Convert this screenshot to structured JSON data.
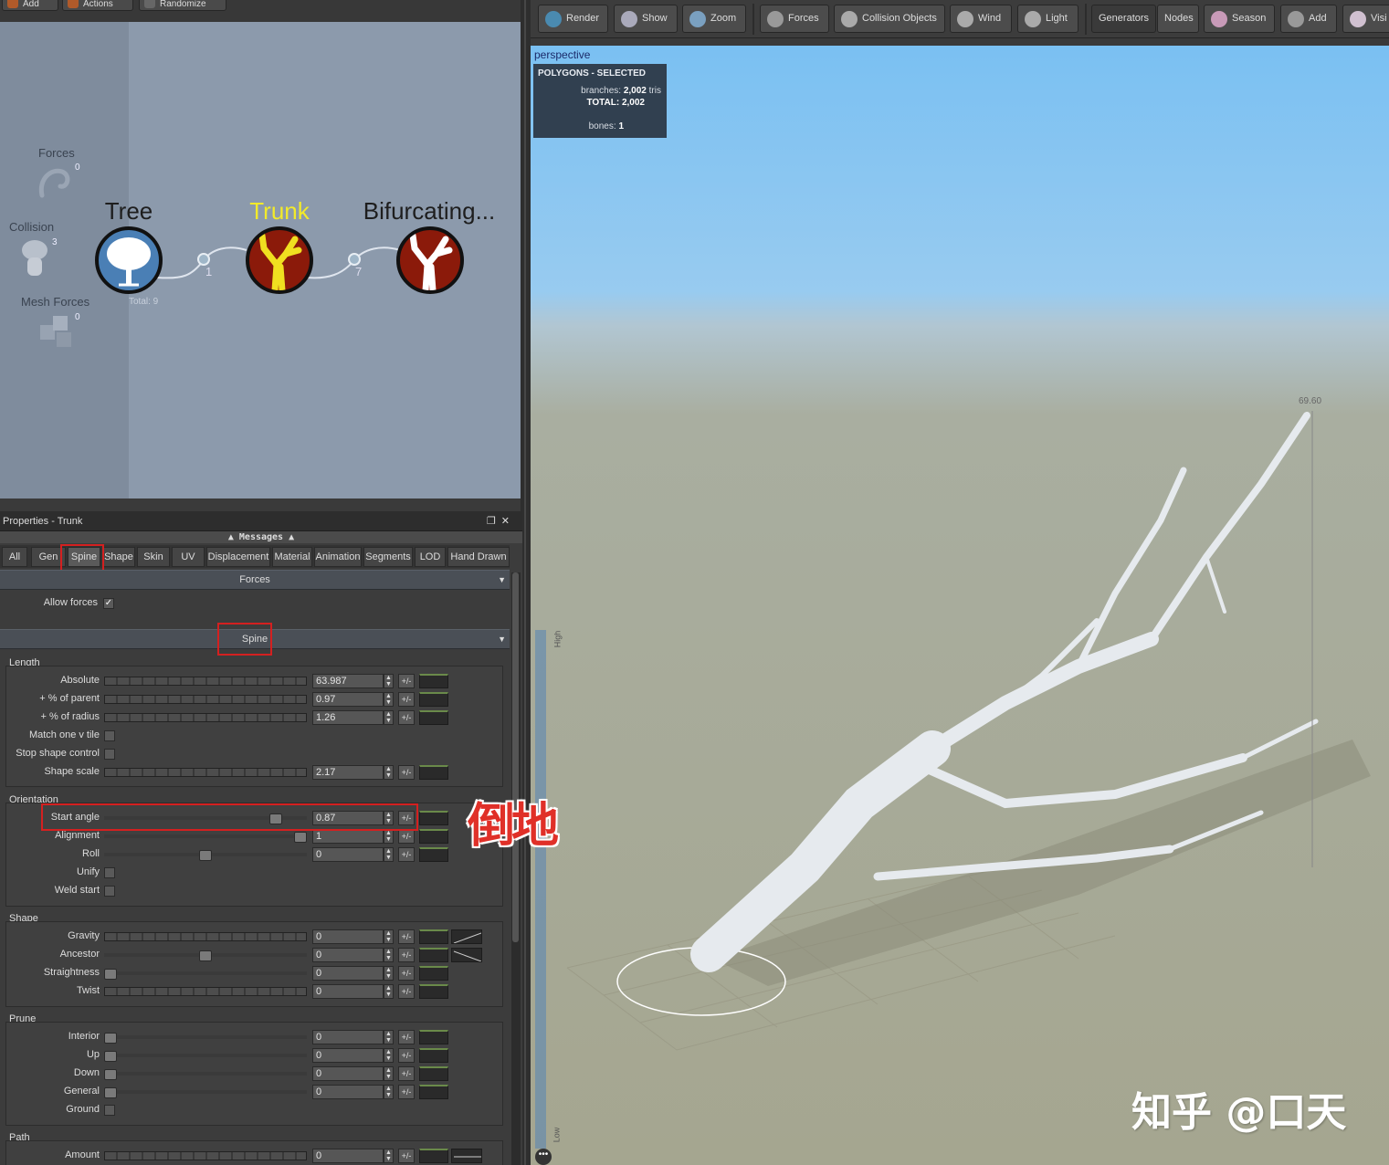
{
  "left_toolbar": {
    "buttons": [
      "Add",
      "Actions",
      "Randomize"
    ]
  },
  "node_graph": {
    "side_items": [
      {
        "label": "Forces",
        "count": "0"
      },
      {
        "label": "Collision",
        "count": "3"
      },
      {
        "label": "Mesh Forces",
        "count": "0"
      }
    ],
    "nodes": [
      {
        "title": "Tree",
        "sub": "Total: 9"
      },
      {
        "title": "Trunk",
        "link": "1"
      },
      {
        "title": "Bifurcating...",
        "link": "7"
      }
    ]
  },
  "properties": {
    "title": "Properties - Trunk",
    "messages": "Messages",
    "tabs": [
      "All",
      "Gen",
      "Spine",
      "Shape",
      "Skin",
      "UV",
      "Displacement",
      "Material",
      "Animation",
      "Segments",
      "LOD",
      "Hand Drawn"
    ],
    "active_tab": "Spine",
    "forces_section": "Forces",
    "allow_forces": {
      "label": "Allow forces",
      "checked": "✓"
    },
    "spine_section": "Spine",
    "length": {
      "label": "Length",
      "rows": [
        {
          "label": "Absolute",
          "value": "63.987"
        },
        {
          "label": "+ % of parent",
          "value": "0.97"
        },
        {
          "label": "+ % of radius",
          "value": "1.26"
        }
      ],
      "checks": [
        "Match one v tile",
        "Stop shape control"
      ],
      "shape_scale": {
        "label": "Shape scale",
        "value": "2.17"
      }
    },
    "orientation": {
      "label": "Orientation",
      "rows": [
        {
          "label": "Start angle",
          "value": "0.87",
          "level": 0.87
        },
        {
          "label": "Alignment",
          "value": "1",
          "level": 1
        },
        {
          "label": "Roll",
          "value": "0",
          "level": 0.5
        }
      ],
      "checks": [
        "Unify",
        "Weld start"
      ]
    },
    "shape": {
      "label": "Shape",
      "rows": [
        {
          "label": "Gravity",
          "value": "0"
        },
        {
          "label": "Ancestor",
          "value": "0"
        },
        {
          "label": "Straightness",
          "value": "0"
        },
        {
          "label": "Twist",
          "value": "0"
        }
      ]
    },
    "prune": {
      "label": "Prune",
      "rows": [
        {
          "label": "Interior",
          "value": "0"
        },
        {
          "label": "Up",
          "value": "0"
        },
        {
          "label": "Down",
          "value": "0"
        },
        {
          "label": "General",
          "value": "0"
        }
      ],
      "ground": "Ground"
    },
    "path": {
      "label": "Path",
      "rows": [
        {
          "label": "Amount",
          "value": "0"
        }
      ]
    },
    "pm_label": "+/-"
  },
  "annotation": "倒地",
  "right_toolbar": {
    "buttons": [
      "Render",
      "Show",
      "Zoom",
      "Forces",
      "Collision Objects",
      "Wind",
      "Light",
      "Generators",
      "Nodes",
      "Season",
      "Add",
      "Visi"
    ]
  },
  "viewport": {
    "label": "perspective",
    "poly_title": "POLYGONS - SELECTED",
    "branches_label": "branches:",
    "branches_value": "2,002",
    "tris": "tris",
    "total_label": "TOTAL:",
    "total_value": "2,002",
    "bones_label": "bones:",
    "bones_value": "1",
    "measure": "69.60",
    "ruler_high": "High",
    "ruler_low": "Low",
    "watermark": "知乎 @口天"
  },
  "colors": {
    "accent_red": "#d42020",
    "trunk_title": "#f2ea2a",
    "node_blue": "#4a7fb5",
    "node_dark_red": "#8b1a0a"
  }
}
